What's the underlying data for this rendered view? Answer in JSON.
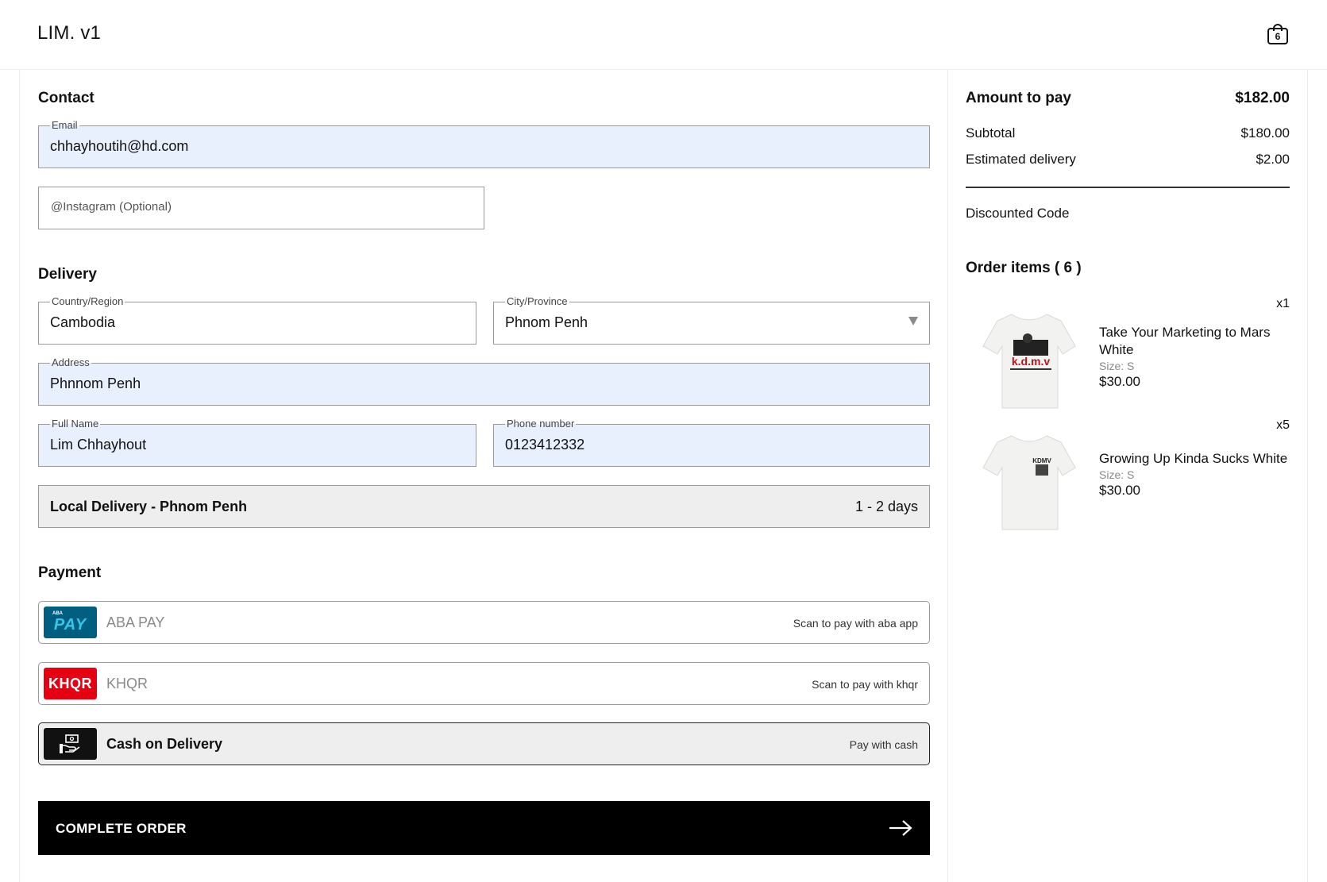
{
  "brand": "LIM. v1",
  "cart": {
    "count": "6"
  },
  "contact": {
    "title": "Contact",
    "email_label": "Email",
    "email_value": "chhayhoutih@hd.com",
    "instagram_placeholder": "@Instagram (Optional)"
  },
  "delivery": {
    "title": "Delivery",
    "country_label": "Country/Region",
    "country_value": "Cambodia",
    "city_label": "City/Province",
    "city_value": "Phnom Penh",
    "address_label": "Address",
    "address_value": "Phnnom Penh",
    "fullname_label": "Full Name",
    "fullname_value": "Lim Chhayhout",
    "phone_label": "Phone number",
    "phone_value": "0123412332",
    "shipping_name": "Local Delivery - Phnom Penh",
    "shipping_days": "1 - 2 days"
  },
  "payment": {
    "title": "Payment",
    "options": [
      {
        "label": "ABA PAY",
        "desc": "Scan to pay with aba app",
        "logo_small": "ABA",
        "logo_big": "PAY",
        "selected": false
      },
      {
        "label": "KHQR",
        "desc": "Scan to pay with khqr",
        "logo_text": "KHQR",
        "selected": false
      },
      {
        "label": "Cash on Delivery",
        "desc": "Pay with cash",
        "selected": true
      }
    ]
  },
  "complete_button": "COMPLETE ORDER",
  "summary": {
    "amount_label": "Amount to pay",
    "amount_value": "$182.00",
    "subtotal_label": "Subtotal",
    "subtotal_value": "$180.00",
    "delivery_label": "Estimated delivery",
    "delivery_value": "$2.00",
    "discount_label": "Discounted Code",
    "order_items_title": "Order items ( 6 )",
    "items": [
      {
        "qty": "x1",
        "name": "Take Your Marketing to Mars White",
        "size": "Size: S",
        "price": "$30.00",
        "print_text": "k.d.m.v"
      },
      {
        "qty": "x5",
        "name": "Growing Up Kinda Sucks White",
        "size": "Size: S",
        "price": "$30.00",
        "print_text": "KDMV"
      }
    ]
  },
  "colors": {
    "autofill_bg": "#e8f0fe",
    "selected_bg": "#eeeeee",
    "aba_bg": "#005f80",
    "aba_accent": "#39c5e8",
    "khqr_red": "#e60012",
    "button_bg": "#000000"
  }
}
